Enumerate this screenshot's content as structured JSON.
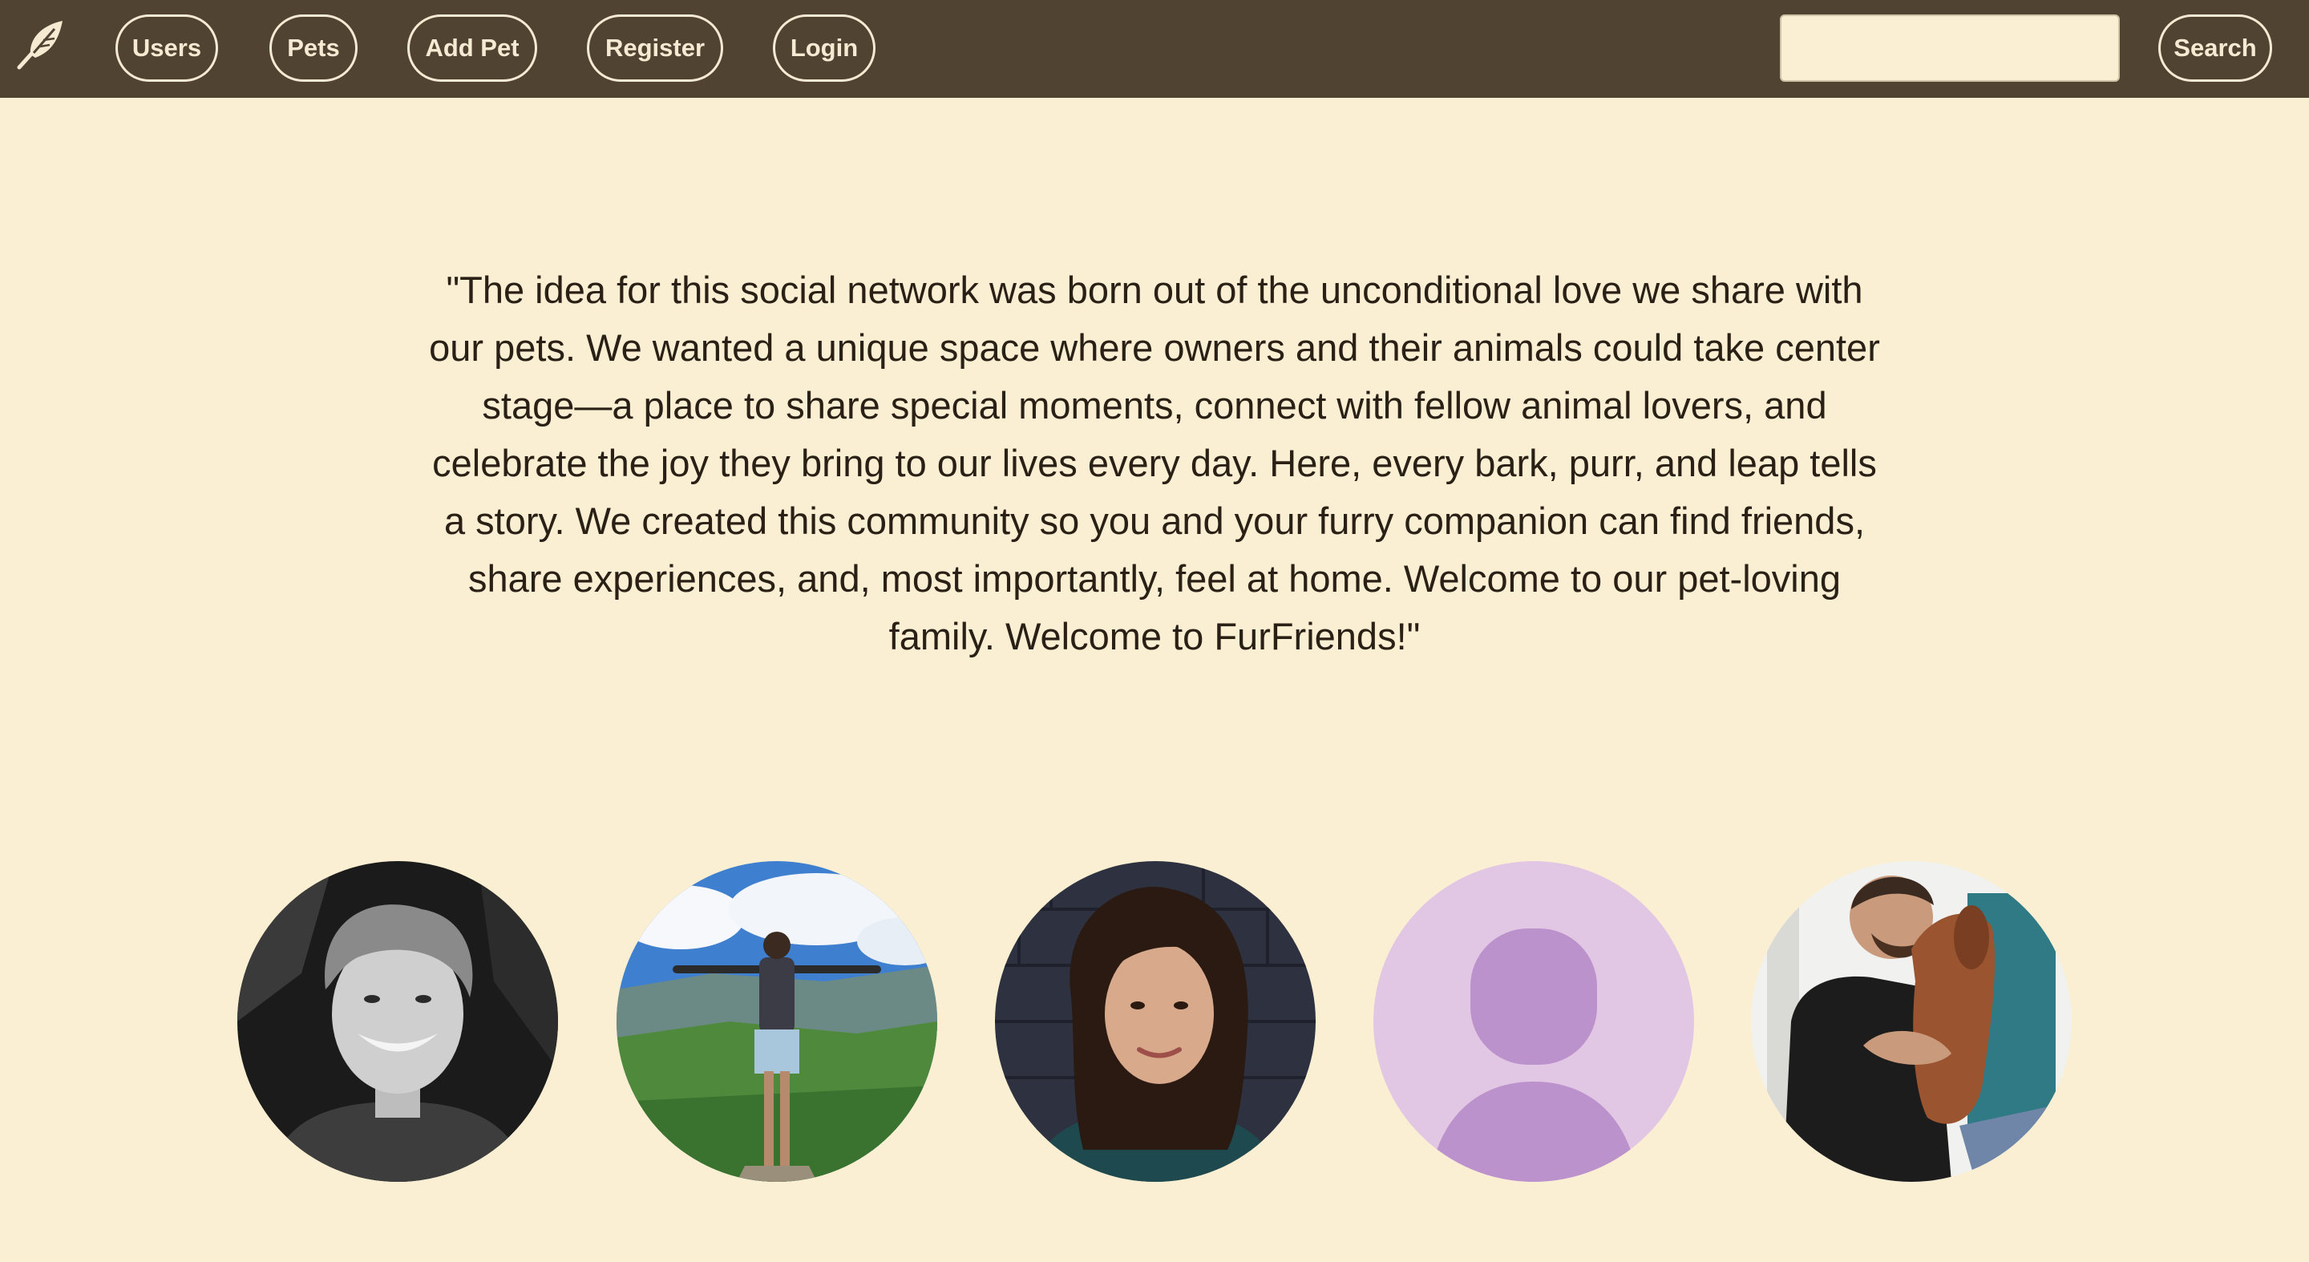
{
  "nav": {
    "items": [
      {
        "label": "Users"
      },
      {
        "label": "Pets"
      },
      {
        "label": "Add Pet"
      },
      {
        "label": "Register"
      },
      {
        "label": "Login"
      }
    ],
    "search_label": "Search",
    "search_value": "",
    "search_placeholder": ""
  },
  "main": {
    "quote": "\"The idea for this social network was born out of the unconditional love we share with our pets. We wanted a unique space where owners and their animals could take center stage—a place to share special moments, connect with fellow animal lovers, and celebrate the joy they bring to our lives every day. Here, every bark, purr, and leap tells a story. We created this community so you and your furry companion can find friends, share experiences, and, most importantly, feel at home. Welcome to our pet-loving family. Welcome to FurFriends!\""
  },
  "colors": {
    "navbar": "#514332",
    "background": "#faefd2",
    "nav_text": "#f5ebd3",
    "text": "#2a2016",
    "placeholder_avatar": "#e2c7e4"
  },
  "icons": {
    "logo": "feather-icon"
  }
}
